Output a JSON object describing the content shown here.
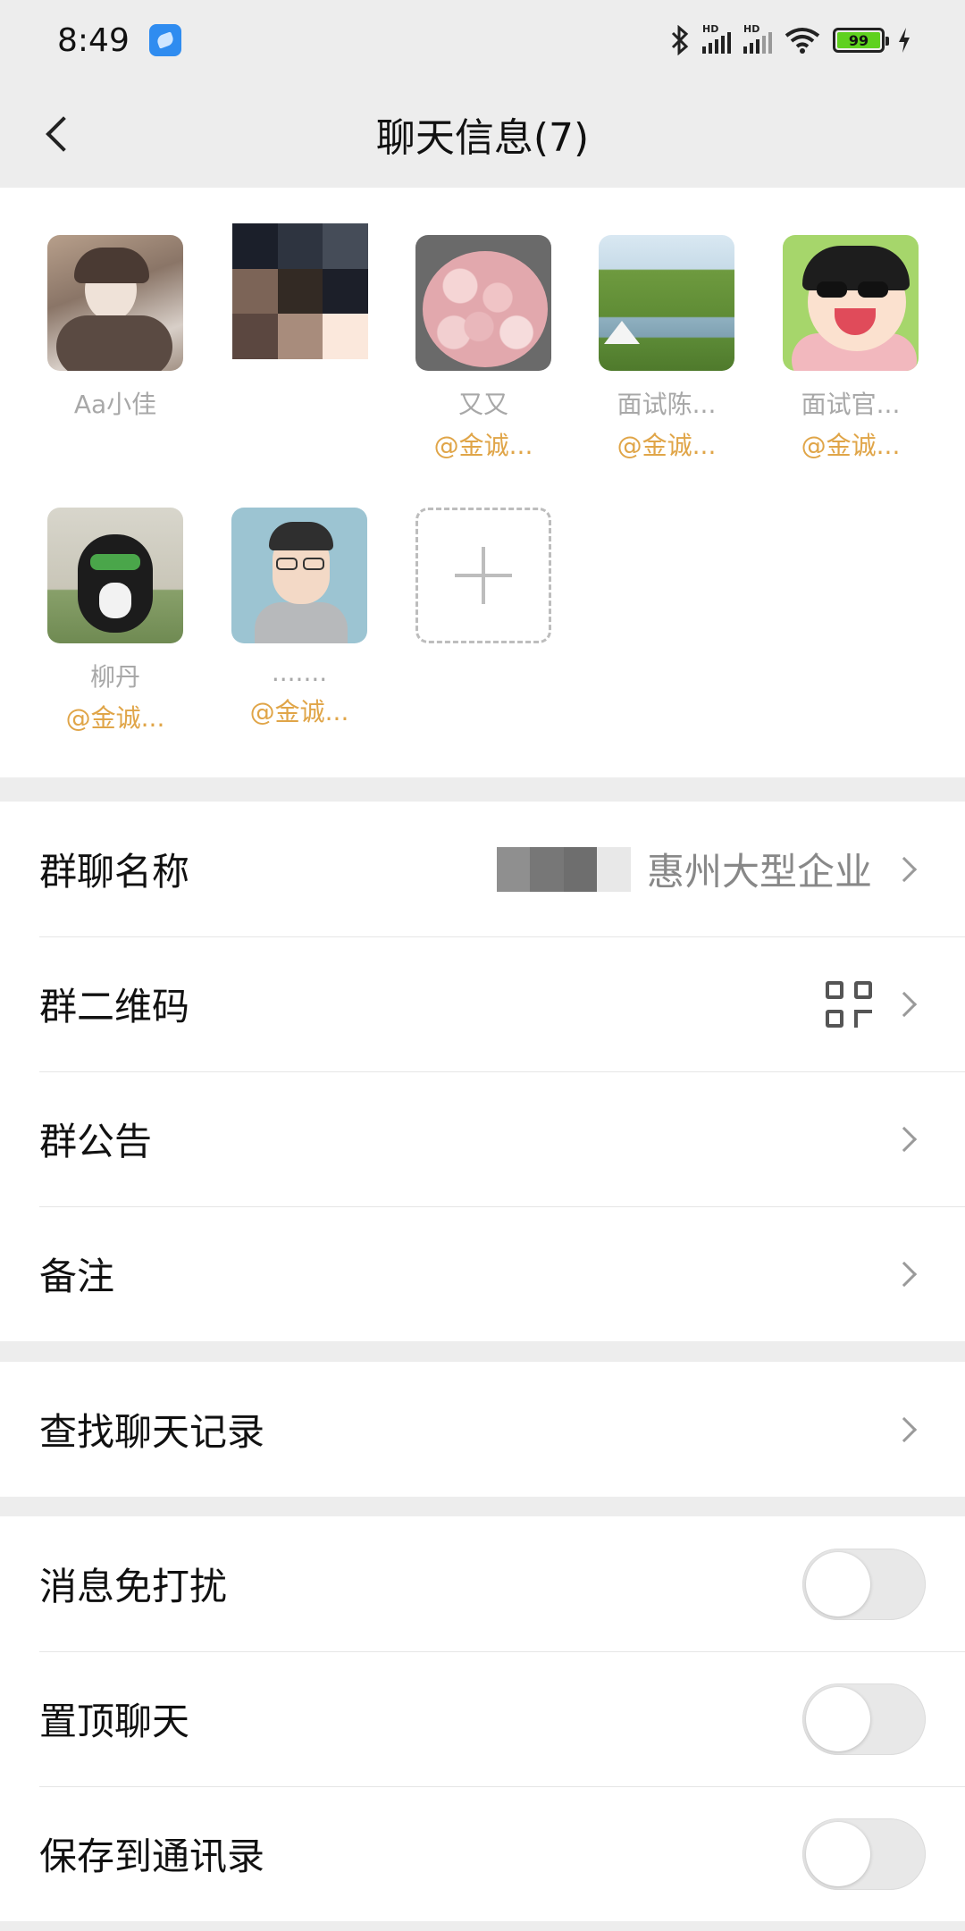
{
  "status_bar": {
    "time": "8:49",
    "battery": "99"
  },
  "nav": {
    "title": "聊天信息(7)"
  },
  "members": [
    {
      "name": "Aa小佳",
      "tag": ""
    },
    {
      "name": "",
      "tag": ""
    },
    {
      "name": "又又",
      "tag": "@金诚..."
    },
    {
      "name": "面试陈...",
      "tag": "@金诚..."
    },
    {
      "name": "面试官...",
      "tag": "@金诚..."
    },
    {
      "name": "柳丹",
      "tag": "@金诚..."
    },
    {
      "name": ".......",
      "tag": "@金诚..."
    }
  ],
  "info_section": {
    "group_name_label": "群聊名称",
    "group_name_value": "惠州大型企业",
    "qr_label": "群二维码",
    "notice_label": "群公告",
    "remark_label": "备注"
  },
  "search_section": {
    "search_label": "查找聊天记录"
  },
  "settings_section": {
    "mute_label": "消息免打扰",
    "mute_on": false,
    "pin_label": "置顶聊天",
    "pin_on": false,
    "save_contacts_label": "保存到通讯录",
    "save_contacts_on": false
  },
  "colors": {
    "tag": "#e0a548",
    "member_name": "#a8a8a8",
    "background": "#ededed"
  }
}
